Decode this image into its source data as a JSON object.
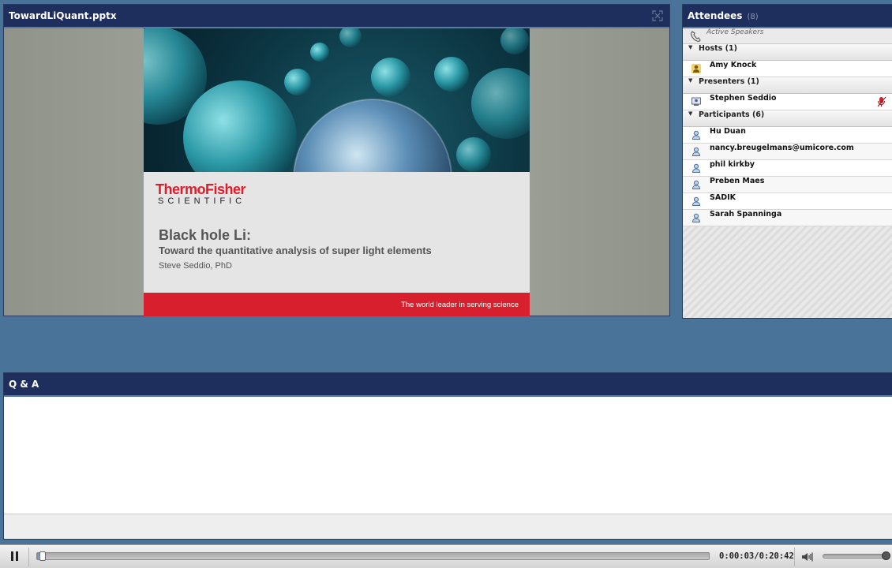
{
  "share_pod": {
    "title": "TowardLiQuant.pptx",
    "slide": {
      "brand_line1": "ThermoFisher",
      "brand_line2": "SCIENTIFIC",
      "title": "Black hole Li:",
      "subtitle": "Toward the quantitative analysis of super light elements",
      "author": "Steve Seddio, PhD",
      "tagline": "The world leader in serving science"
    }
  },
  "attendees_pod": {
    "title": "Attendees",
    "count": "(8)",
    "active_speakers_label": "Active Speakers",
    "groups": [
      {
        "label": "Hosts (1)",
        "members": [
          "Amy Knock"
        ]
      },
      {
        "label": "Presenters (1)",
        "members": [
          "Stephen Seddio"
        ]
      },
      {
        "label": "Participants (6)",
        "members": [
          "Hu Duan",
          "nancy.breugelmans@umicore.com",
          "phil kirkby",
          "Preben Maes",
          "SADIK",
          "Sarah Spanninga"
        ]
      }
    ]
  },
  "qa_pod": {
    "title": "Q & A"
  },
  "playback": {
    "time": "0:00:03/0:20:42",
    "progress_fraction": 0.0024,
    "volume_fraction": 1.0
  },
  "icons": [
    "fullscreen-icon",
    "phone-icon",
    "host-icon",
    "presenter-icon",
    "participant-icon",
    "microphone-icon",
    "pause-icon",
    "volume-icon",
    "collapse-triangle-icon"
  ],
  "colors": {
    "background": "#4a7399",
    "pod_header": "#1e2f5e",
    "brand_red": "#d71f2d",
    "slide_gray": "#e5e5e5"
  }
}
